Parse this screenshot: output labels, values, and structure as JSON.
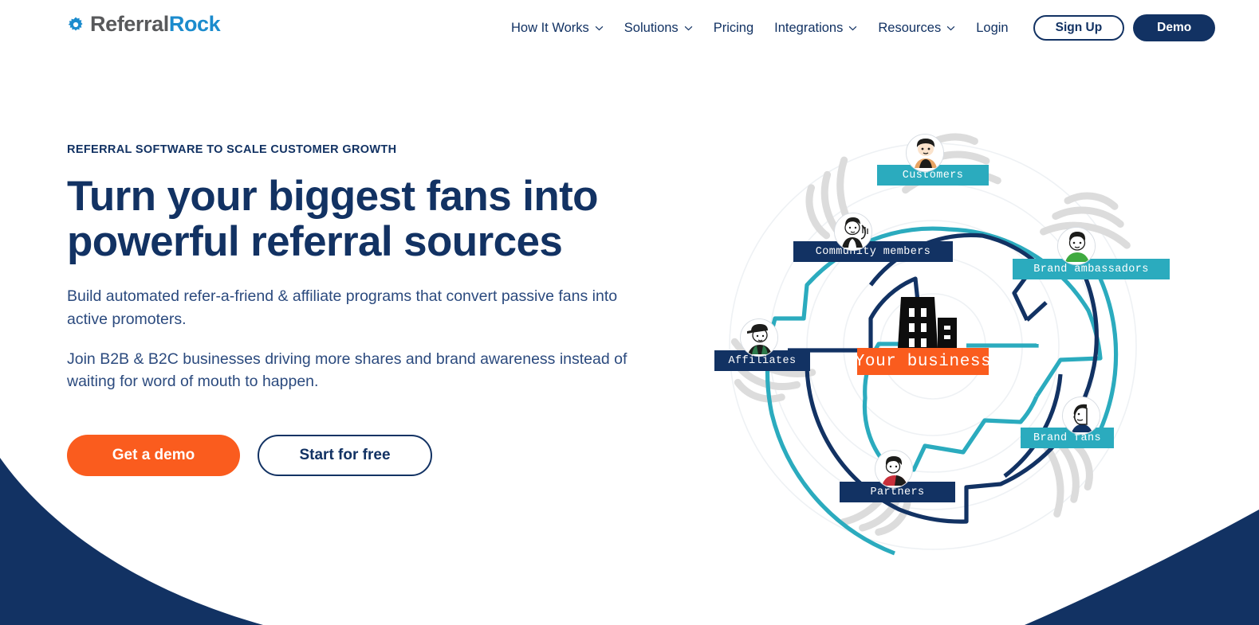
{
  "brand": {
    "logo_text_primary": "Referral",
    "logo_text_secondary": "Rock",
    "icon": "gear-icon",
    "colors": {
      "navy": "#123263",
      "blue": "#1b8bcd",
      "orange": "#fa5c1e",
      "teal": "#2babbe",
      "gray": "#58595b"
    }
  },
  "header": {
    "nav": [
      {
        "label": "How It Works",
        "has_dropdown": true
      },
      {
        "label": "Solutions",
        "has_dropdown": true
      },
      {
        "label": "Pricing",
        "has_dropdown": false
      },
      {
        "label": "Integrations",
        "has_dropdown": true
      },
      {
        "label": "Resources",
        "has_dropdown": true
      },
      {
        "label": "Login",
        "has_dropdown": false
      }
    ],
    "signup_label": "Sign Up",
    "demo_label": "Demo"
  },
  "hero": {
    "eyebrow": "REFERRAL SOFTWARE TO SCALE CUSTOMER GROWTH",
    "headline": "Turn your biggest fans into powerful referral sources",
    "paragraph_1": "Build automated refer-a-friend & affiliate programs that convert passive fans into active promoters.",
    "paragraph_2": "Join B2B & B2C businesses driving more shares and brand awareness instead of waiting for word of mouth to happen.",
    "cta_primary": "Get a demo",
    "cta_secondary": "Start for free"
  },
  "illustration": {
    "center_label": "Your business",
    "center_color": "#fa5c1e",
    "center_icon": "office-building-icon",
    "nodes": [
      {
        "label": "Customers",
        "color": "#2babbe",
        "avatar": "avatar-curly-hair-person-icon"
      },
      {
        "label": "Brand ambassadors",
        "color": "#2babbe",
        "avatar": "avatar-green-shirt-person-icon"
      },
      {
        "label": "Brand fans",
        "color": "#2babbe",
        "avatar": "avatar-side-profile-person-icon"
      },
      {
        "label": "Partners",
        "color": "#123263",
        "avatar": "avatar-red-jacket-person-icon"
      },
      {
        "label": "Affiliates",
        "color": "#123263",
        "avatar": "avatar-cap-person-icon"
      },
      {
        "label": "Community members",
        "color": "#123263",
        "avatar": "avatar-waving-person-icon"
      }
    ]
  }
}
